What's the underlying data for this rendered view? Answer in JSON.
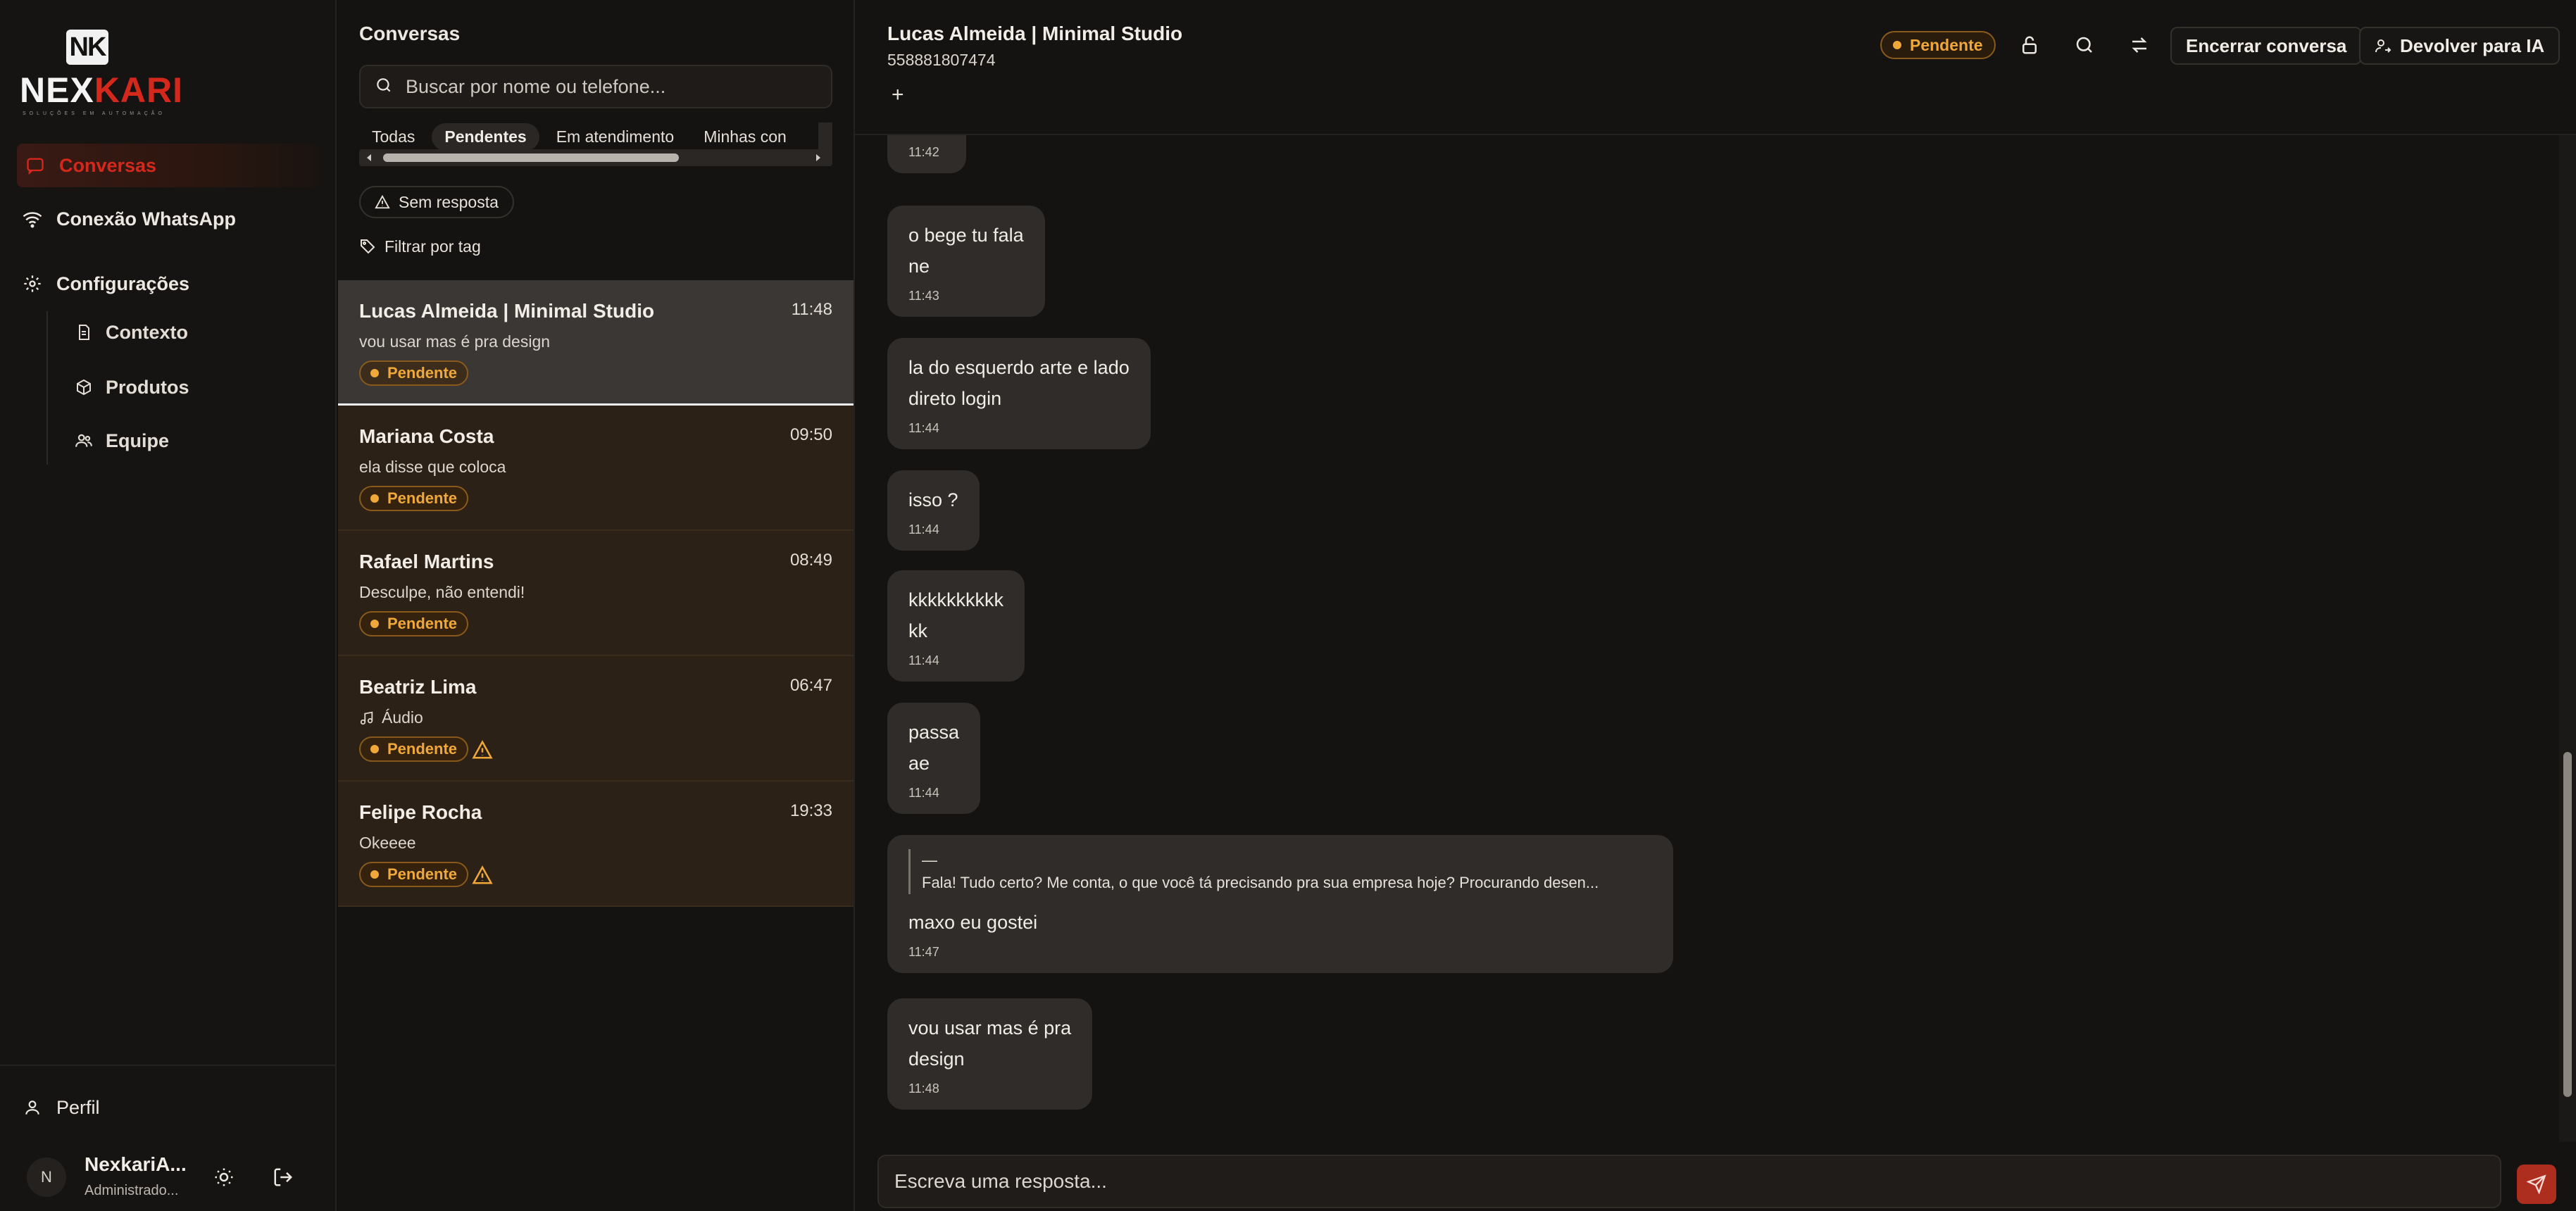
{
  "brand": {
    "badge": "NK",
    "word_part1": "NEX",
    "word_part2": "KARI",
    "tagline": "SOLUÇÕES EM AUTOMAÇÃO"
  },
  "colors": {
    "accent_red": "#d5281c",
    "pending_orange": "#f0a83a",
    "send_button": "#ad2d1e"
  },
  "sidebar": {
    "items": [
      {
        "label": "Conversas",
        "icon": "chat-icon",
        "active": true
      },
      {
        "label": "Conexão WhatsApp",
        "icon": "wifi-icon"
      },
      {
        "label": "Configurações",
        "icon": "gear-icon"
      }
    ],
    "sub_items": [
      {
        "label": "Contexto",
        "icon": "document-icon"
      },
      {
        "label": "Produtos",
        "icon": "box-icon"
      },
      {
        "label": "Equipe",
        "icon": "users-icon"
      }
    ],
    "profile_label": "Perfil",
    "user": {
      "initial": "N",
      "name": "NexkariA...",
      "role": "Administrado..."
    }
  },
  "conversations": {
    "title": "Conversas",
    "search_placeholder": "Buscar por nome ou telefone...",
    "tabs": [
      "Todas",
      "Pendentes",
      "Em atendimento",
      "Minhas con"
    ],
    "active_tab": "Pendentes",
    "chip_no_reply": "Sem resposta",
    "filter_tag": "Filtrar por tag",
    "items": [
      {
        "name": "Lucas Almeida | Minimal Studio",
        "time": "11:48",
        "preview": "vou usar mas é pra design",
        "status": "Pendente",
        "warning": false
      },
      {
        "name": "Mariana Costa",
        "time": "09:50",
        "preview": "ela disse que coloca",
        "status": "Pendente",
        "warning": false
      },
      {
        "name": "Rafael Martins",
        "time": "08:49",
        "preview": "Desculpe, não entendi!",
        "status": "Pendente",
        "warning": false
      },
      {
        "name": "Beatriz Lima",
        "time": "06:47",
        "preview": "Áudio",
        "status": "Pendente",
        "warning": true
      },
      {
        "name": "Felipe Rocha",
        "time": "19:33",
        "preview": "Okeeee",
        "status": "Pendente",
        "warning": true
      }
    ]
  },
  "chat": {
    "contact_name": "Lucas Almeida | Minimal Studio",
    "phone": "558881807474",
    "add_label": "+",
    "status": "Pendente",
    "end_button": "Encerrar conversa",
    "return_button": "Devolver para IA",
    "messages": [
      {
        "lines": [
          "o bege tu fala",
          "ne"
        ],
        "time": "11:43"
      },
      {
        "lines": [
          "la do esquerdo arte e lado",
          "direto login"
        ],
        "time": "11:44"
      },
      {
        "lines": [
          "isso ?"
        ],
        "time": "11:44"
      },
      {
        "lines": [
          "kkkkkkkkkk",
          "kk"
        ],
        "time": "11:44"
      },
      {
        "lines": [
          "passa",
          "ae"
        ],
        "time": "11:44"
      },
      {
        "quote_author": "—",
        "quote": "Fala! Tudo certo? Me conta, o que você tá precisando pra sua empresa hoje? Procurando desen...",
        "lines": [
          "maxo eu gostei"
        ],
        "time": "11:47"
      },
      {
        "lines": [
          "vou usar mas é pra",
          "design"
        ],
        "time": "11:48"
      }
    ],
    "first_partial_time": "11:42",
    "composer_placeholder": "Escreva uma resposta..."
  }
}
